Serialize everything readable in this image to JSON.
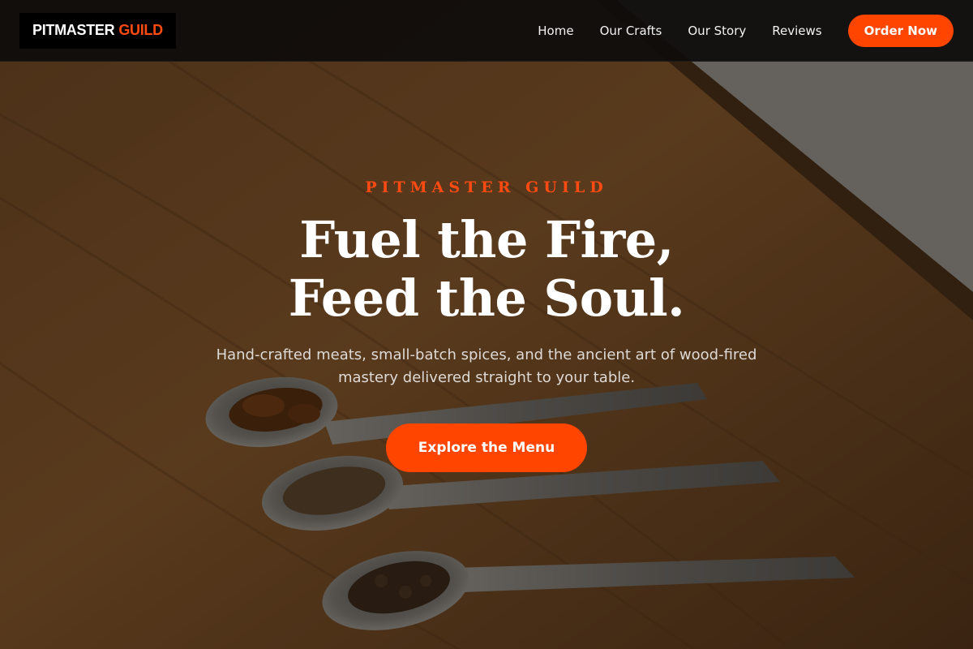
{
  "header": {
    "logo": {
      "part1": "PITMASTER",
      "part2": "GUILD"
    },
    "nav": [
      {
        "label": "Home"
      },
      {
        "label": "Our Crafts"
      },
      {
        "label": "Our Story"
      },
      {
        "label": "Reviews"
      }
    ],
    "order_button": "Order Now"
  },
  "hero": {
    "eyebrow": "PITMASTER GUILD",
    "title_line1": "Fuel the Fire,",
    "title_line2": "Feed the Soul.",
    "subtitle": "Hand-crafted meats, small-batch spices, and the ancient art of wood-fired mastery delivered straight to your table.",
    "cta": "Explore the Menu"
  },
  "colors": {
    "accent": "#ff4500",
    "header_bg": "#0e0c0b",
    "text_light": "#ffffff"
  }
}
